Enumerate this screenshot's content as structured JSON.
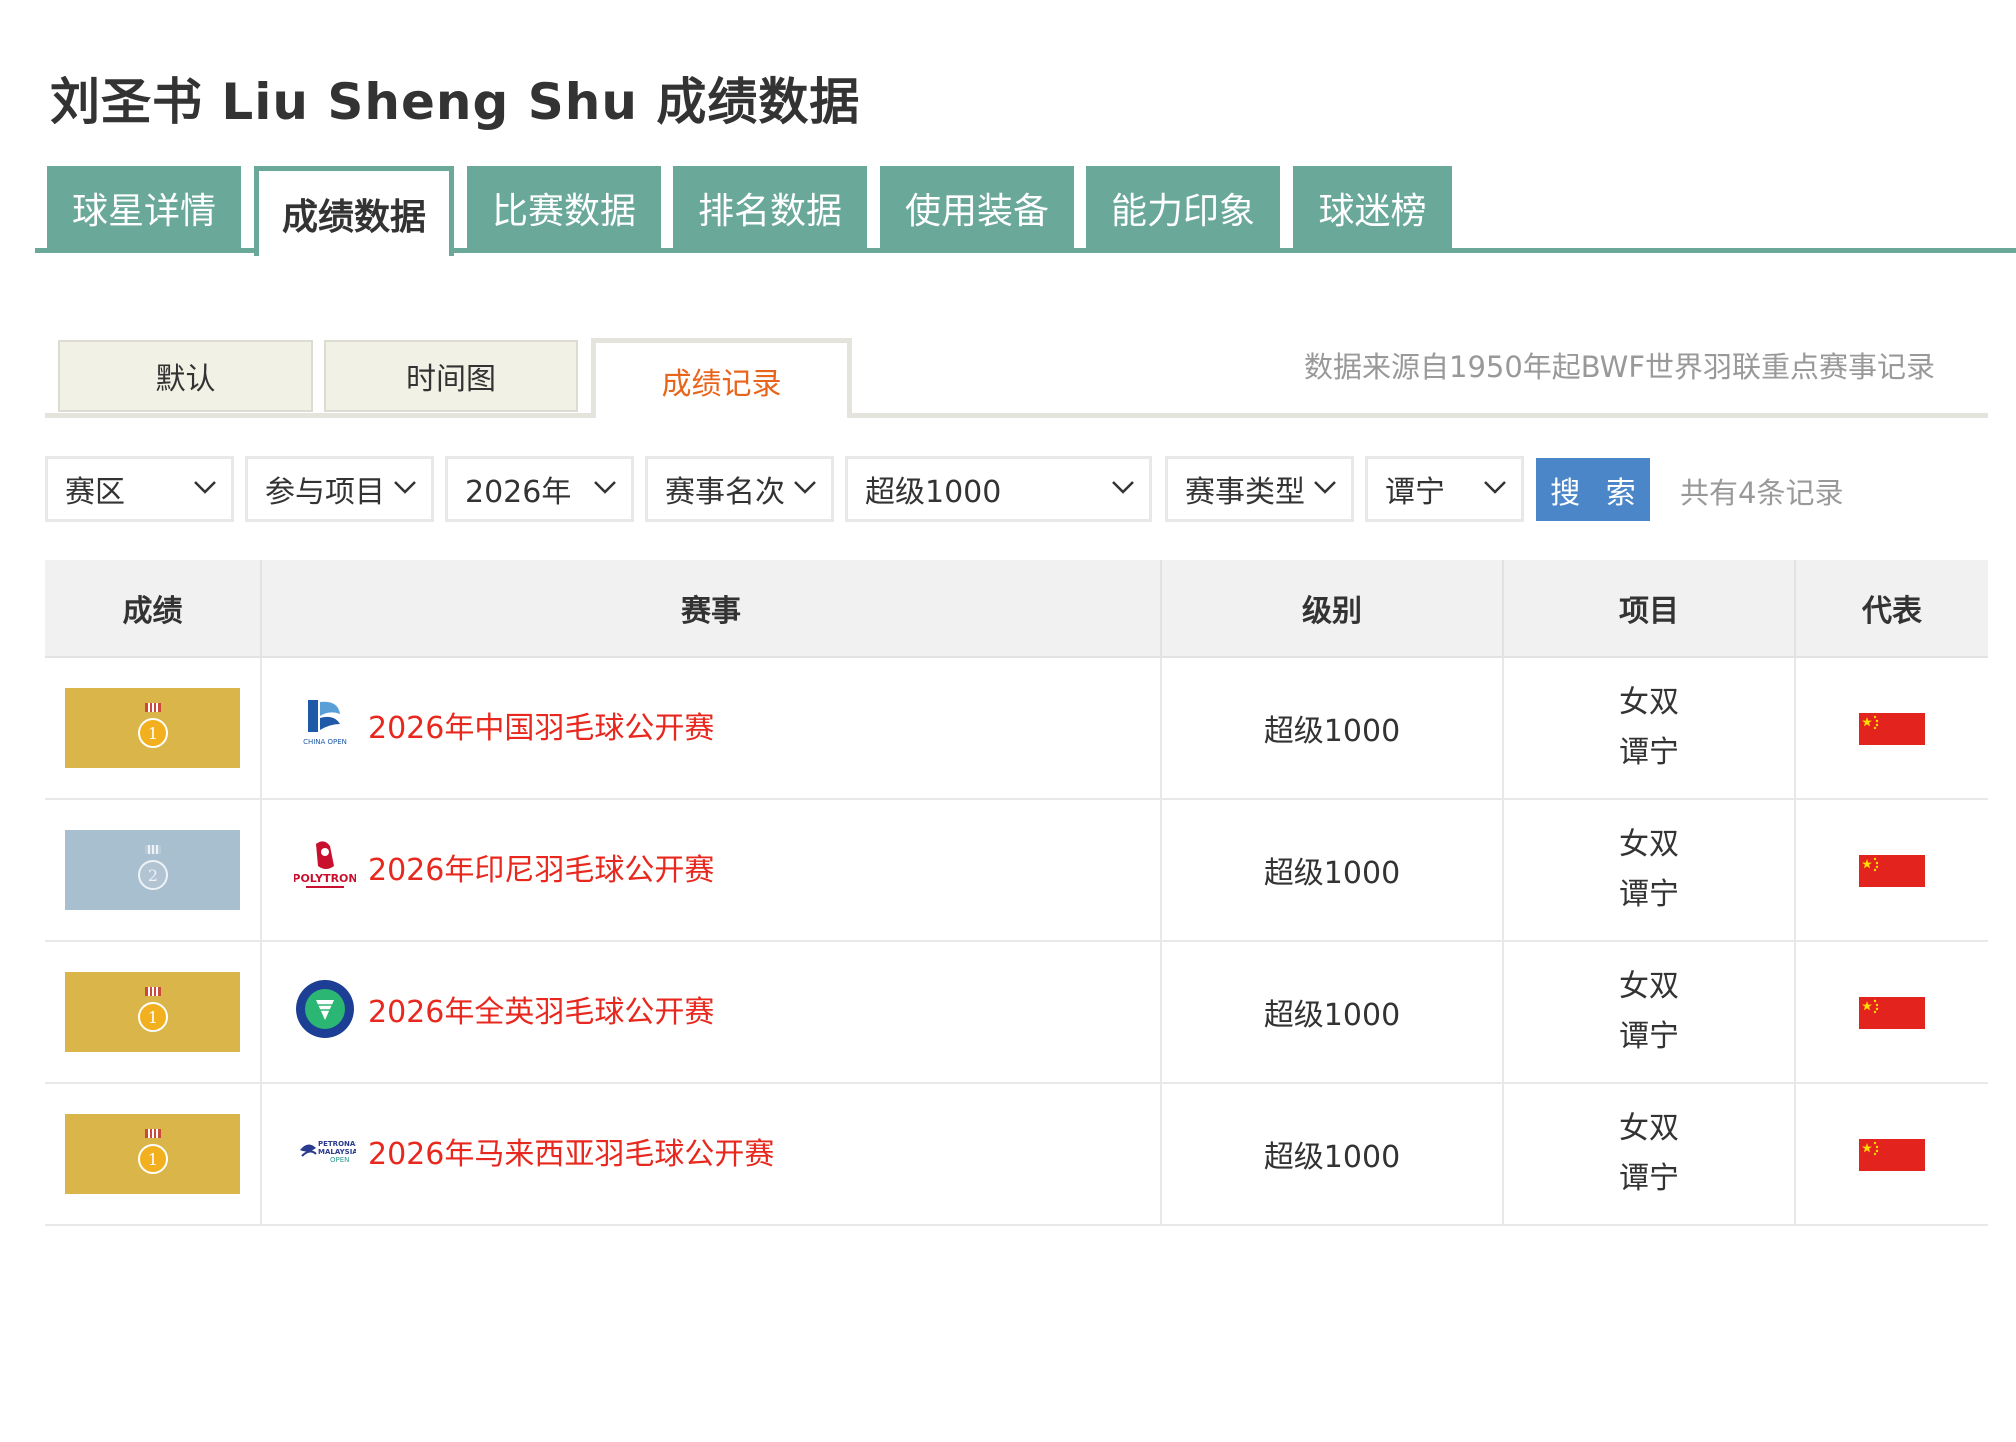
{
  "page": {
    "title": "刘圣书 Liu Sheng Shu 成绩数据"
  },
  "main_tabs": [
    {
      "label": "球星详情"
    },
    {
      "label": "成绩数据",
      "active": true
    },
    {
      "label": "比赛数据"
    },
    {
      "label": "排名数据"
    },
    {
      "label": "使用装备"
    },
    {
      "label": "能力印象"
    },
    {
      "label": "球迷榜"
    }
  ],
  "sub_tabs": [
    {
      "label": "默认"
    },
    {
      "label": "时间图"
    },
    {
      "label": "成绩记录",
      "active": true
    }
  ],
  "source_note": "数据来源自1950年起BWF世界羽联重点赛事记录",
  "filters": {
    "region": "赛区",
    "discipline": "参与项目",
    "year": "2026年",
    "placement": "赛事名次",
    "level": "超级1000",
    "event_type": "赛事类型",
    "partner": "谭宁"
  },
  "search_button": "搜 索",
  "record_count": "共有4条记录",
  "table": {
    "headers": {
      "result": "成绩",
      "event": "赛事",
      "level": "级别",
      "item": "项目",
      "represent": "代表"
    },
    "rows": [
      {
        "medal": "gold",
        "medal_number": "1",
        "logo": "china-open-logo-icon",
        "event": "2026年中国羽毛球公开赛",
        "level": "超级1000",
        "item": "女双",
        "partner": "谭宁",
        "flag": "china-flag-icon"
      },
      {
        "medal": "silver",
        "medal_number": "2",
        "logo": "indonesia-open-logo-icon",
        "event": "2026年印尼羽毛球公开赛",
        "level": "超级1000",
        "item": "女双",
        "partner": "谭宁",
        "flag": "china-flag-icon"
      },
      {
        "medal": "gold",
        "medal_number": "1",
        "logo": "all-england-logo-icon",
        "event": "2026年全英羽毛球公开赛",
        "level": "超级1000",
        "item": "女双",
        "partner": "谭宁",
        "flag": "china-flag-icon"
      },
      {
        "medal": "gold",
        "medal_number": "1",
        "logo": "malaysia-open-logo-icon",
        "event": "2026年马来西亚羽毛球公开赛",
        "level": "超级1000",
        "item": "女双",
        "partner": "谭宁",
        "flag": "china-flag-icon"
      }
    ]
  },
  "colors": {
    "tab_green": "#6aa89a",
    "active_subtab_orange": "#e8651c",
    "event_link_red": "#e8281e",
    "search_blue": "#4a86c8",
    "gold_medal_bg": "#dab54a",
    "silver_medal_bg": "#a8bfd0"
  }
}
